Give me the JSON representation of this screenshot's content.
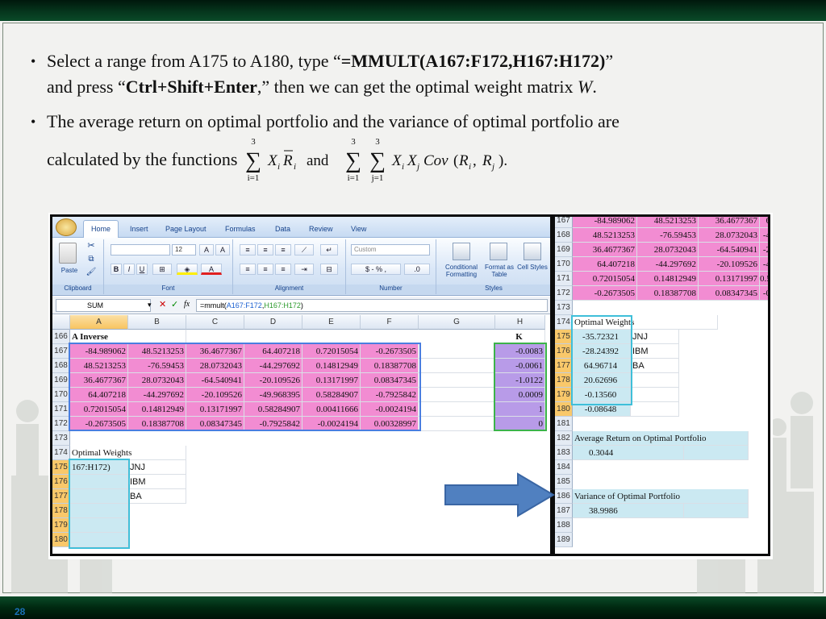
{
  "slide": {
    "page_number": "28",
    "bullet1": {
      "text_a": "Select a range from A175 to A180, type “",
      "formula": "=MMULT(A167:F172,H167:H172)",
      "text_b": "”",
      "text_c": "and  press “",
      "keys": "Ctrl+Shift+Enter",
      "text_d": ",” then we can get the optimal weight matrix ",
      "w": "W",
      "text_e": "."
    },
    "bullet2": {
      "line1": "The average return on optimal portfolio and the variance of optimal portfolio are",
      "line2": "calculated by the functions",
      "math_and": "and",
      "sum_top": "3",
      "sum_bot_i": "i=1",
      "sum_bot_j": "j=1",
      "term1_x": "X",
      "term1_i": "i",
      "term1_r": "R",
      "term2_x": "X",
      "term2_j": "j",
      "term2_cov": "Cov",
      "term2_args_open": "(",
      "term2_r": "R",
      "term2_comma": ", ",
      "term2_close": ").",
      "sub_i": "i",
      "sub_j": "j"
    }
  },
  "excel": {
    "tabs": [
      "Home",
      "Insert",
      "Page Layout",
      "Formulas",
      "Data",
      "Review",
      "View"
    ],
    "groups": {
      "clipboard": "Clipboard",
      "paste": "Paste",
      "font": "Font",
      "font_size": "12",
      "alignment": "Alignment",
      "number": "Number",
      "number_format": "Custom",
      "number_btns": "$ - % ,",
      "styles": "Styles",
      "cond_fmt": "Conditional Formatting",
      "fmt_table": "Format as Table",
      "cell_styles": "Cell Styles"
    },
    "name_box": "SUM",
    "fx": "fx",
    "formula_prefix": "=mmult(",
    "formula_ref1": "A167:F172",
    "formula_comma": ",",
    "formula_ref2": "H167:H172",
    "formula_suffix": ")",
    "columns": [
      "A",
      "B",
      "C",
      "D",
      "E",
      "F",
      "G",
      "H"
    ],
    "a_inverse_label": "A Inverse",
    "k_label": "K",
    "matrix": [
      [
        "-84.989062",
        "48.5213253",
        "36.4677367",
        "64.407218",
        "0.72015054",
        "-0.2673505"
      ],
      [
        "48.5213253",
        "-76.59453",
        "28.0732043",
        "-44.297692",
        "0.14812949",
        "0.18387708"
      ],
      [
        "36.4677367",
        "28.0732043",
        "-64.540941",
        "-20.109526",
        "0.13171997",
        "0.08347345"
      ],
      [
        "64.407218",
        "-44.297692",
        "-20.109526",
        "-49.968395",
        "0.58284907",
        "-0.7925842"
      ],
      [
        "0.72015054",
        "0.14812949",
        "0.13171997",
        "0.58284907",
        "0.00411666",
        "-0.0024194"
      ],
      [
        "-0.2673505",
        "0.18387708",
        "0.08347345",
        "-0.7925842",
        "-0.0024194",
        "0.00328997"
      ]
    ],
    "k_values": [
      "-0.0083",
      "-0.0061",
      "-1.0122",
      "0.0009",
      "1",
      "0"
    ],
    "left_rows": [
      "166",
      "167",
      "168",
      "169",
      "170",
      "171",
      "172",
      "173",
      "174",
      "175",
      "176",
      "177",
      "178",
      "179",
      "180"
    ],
    "optimal_weights_label": "Optimal Weights",
    "editing_cell": "167:H172)",
    "tickers": [
      "JNJ",
      "IBM",
      "BA"
    ]
  },
  "result": {
    "top_rows": [
      {
        "row": "167",
        "a": "-84.989062",
        "b": "48.5213253",
        "c": "36.4677367",
        "d": "6"
      },
      {
        "row": "168",
        "a": "48.5213253",
        "b": "-76.59453",
        "c": "28.0732043",
        "d": "-4"
      },
      {
        "row": "169",
        "a": "36.4677367",
        "b": "28.0732043",
        "c": "-64.540941",
        "d": "-2"
      },
      {
        "row": "170",
        "a": "64.407218",
        "b": "-44.297692",
        "c": "-20.109526",
        "d": "-4"
      },
      {
        "row": "171",
        "a": "0.72015054",
        "b": "0.14812949",
        "c": "0.13171997",
        "d": "0.5"
      },
      {
        "row": "172",
        "a": "-0.2673505",
        "b": "0.18387708",
        "c": "0.08347345",
        "d": "-0"
      }
    ],
    "row173": "173",
    "row174": "174",
    "optimal_weights_label": "Optimal Weights",
    "weights": [
      {
        "row": "175",
        "value": "-35.72321",
        "ticker": "JNJ"
      },
      {
        "row": "176",
        "value": "-28.24392",
        "ticker": "IBM"
      },
      {
        "row": "177",
        "value": "64.96714",
        "ticker": "BA"
      },
      {
        "row": "178",
        "value": "20.62696",
        "ticker": ""
      },
      {
        "row": "179",
        "value": "-0.13560",
        "ticker": ""
      },
      {
        "row": "180",
        "value": "-0.08648",
        "ticker": ""
      }
    ],
    "rows_after": [
      "181",
      "182",
      "183",
      "184",
      "185",
      "186",
      "187",
      "188",
      "189"
    ],
    "avg_return_label": "Average Return on Optimal Portfolio",
    "avg_return_value": "0.3044",
    "variance_label": "Variance of Optimal Portfolio",
    "variance_value": "38.9986"
  },
  "colors": {
    "matrix_fill": "#f28cd2",
    "k_fill": "#b89be8",
    "selection_fill": "#cbe9f2",
    "arrow_fill": "#5080c0"
  }
}
